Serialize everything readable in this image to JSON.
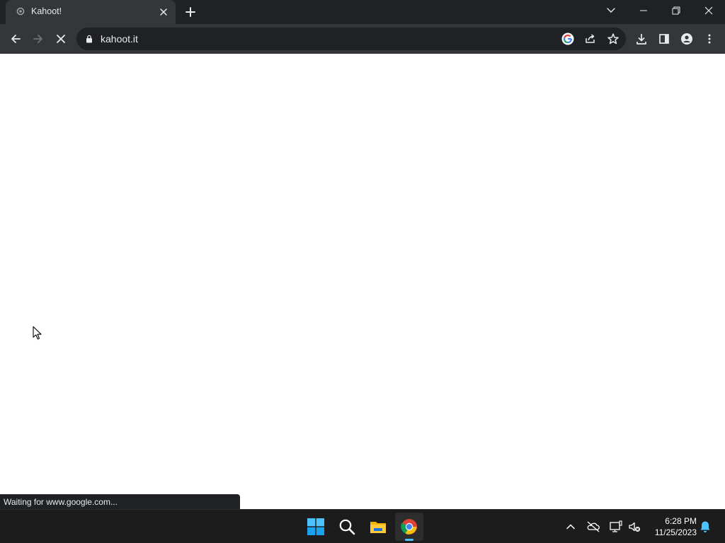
{
  "browser": {
    "tab": {
      "title": "Kahoot!"
    },
    "address_bar": {
      "url": "kahoot.it"
    },
    "status_bubble": "Waiting for www.google.com..."
  },
  "taskbar": {
    "clock": {
      "time": "6:28 PM",
      "date": "11/25/2023"
    }
  },
  "colors": {
    "chrome_dark": "#202124",
    "chrome_toolbar": "#35363a",
    "taskbar_bg": "#1c1c1c",
    "accent_blue": "#4cc2ff"
  }
}
